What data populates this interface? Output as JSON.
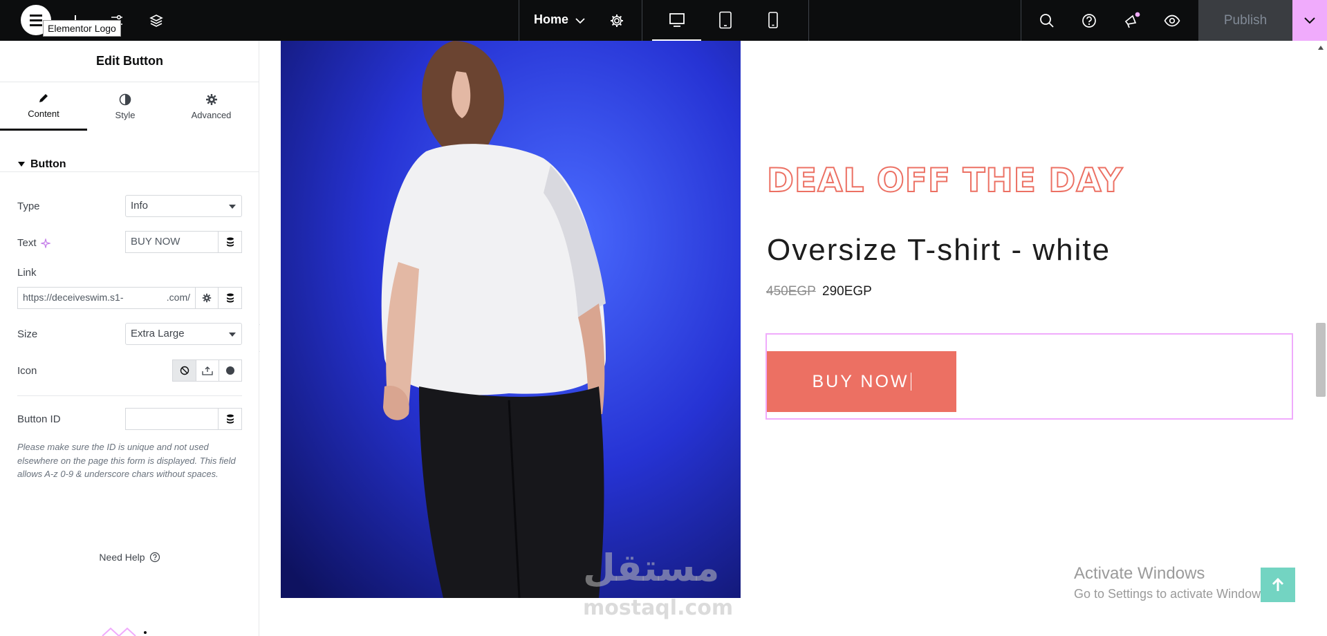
{
  "topbar": {
    "logo_tooltip": "Elementor Logo",
    "page_name": "Home",
    "publish_label": "Publish",
    "icons": [
      "menu-icon",
      "plus-icon",
      "sliders-icon",
      "layers-icon",
      "chevron-down-icon",
      "gear-icon",
      "desktop-icon",
      "tablet-icon",
      "mobile-icon",
      "search-icon",
      "help-icon",
      "megaphone-icon",
      "eye-icon",
      "chevron-down-icon"
    ]
  },
  "panel": {
    "title": "Edit Button",
    "tabs": [
      {
        "label": "Content",
        "icon": "pencil-icon",
        "active": true
      },
      {
        "label": "Style",
        "icon": "contrast-icon",
        "active": false
      },
      {
        "label": "Advanced",
        "icon": "gear-icon",
        "active": false
      }
    ],
    "section_title": "Button",
    "fields": {
      "type_label": "Type",
      "type_value": "Info",
      "text_label": "Text",
      "text_value": "BUY NOW",
      "link_label": "Link",
      "link_value_start": "https://deceiveswim.s1-",
      "link_value_end": ".com/",
      "size_label": "Size",
      "size_value": "Extra Large",
      "icon_label": "Icon",
      "button_id_label": "Button ID",
      "button_id_value": ""
    },
    "note": "Please make sure the ID is unique and not used elsewhere on the page this form is displayed. This field allows A-z 0-9 & underscore chars without spaces.",
    "help_label": "Need Help"
  },
  "canvas": {
    "deal_heading": "DEAL OFF THE DAY",
    "product_title": "Oversize T-shirt - white",
    "old_price": "450EGP",
    "new_price": "290EGP",
    "button_label": "BUY NOW",
    "watermark_title": "Activate Windows",
    "watermark_sub": "Go to Settings to activate Windows.",
    "site_watermark_ar": "مستقل",
    "site_watermark_en": "mostaql.com"
  },
  "colors": {
    "topbar_bg": "#0c0d0e",
    "accent_pink": "#f0abfc",
    "button_coral": "#ec7063",
    "scroll_top_teal": "#73d4c2"
  }
}
